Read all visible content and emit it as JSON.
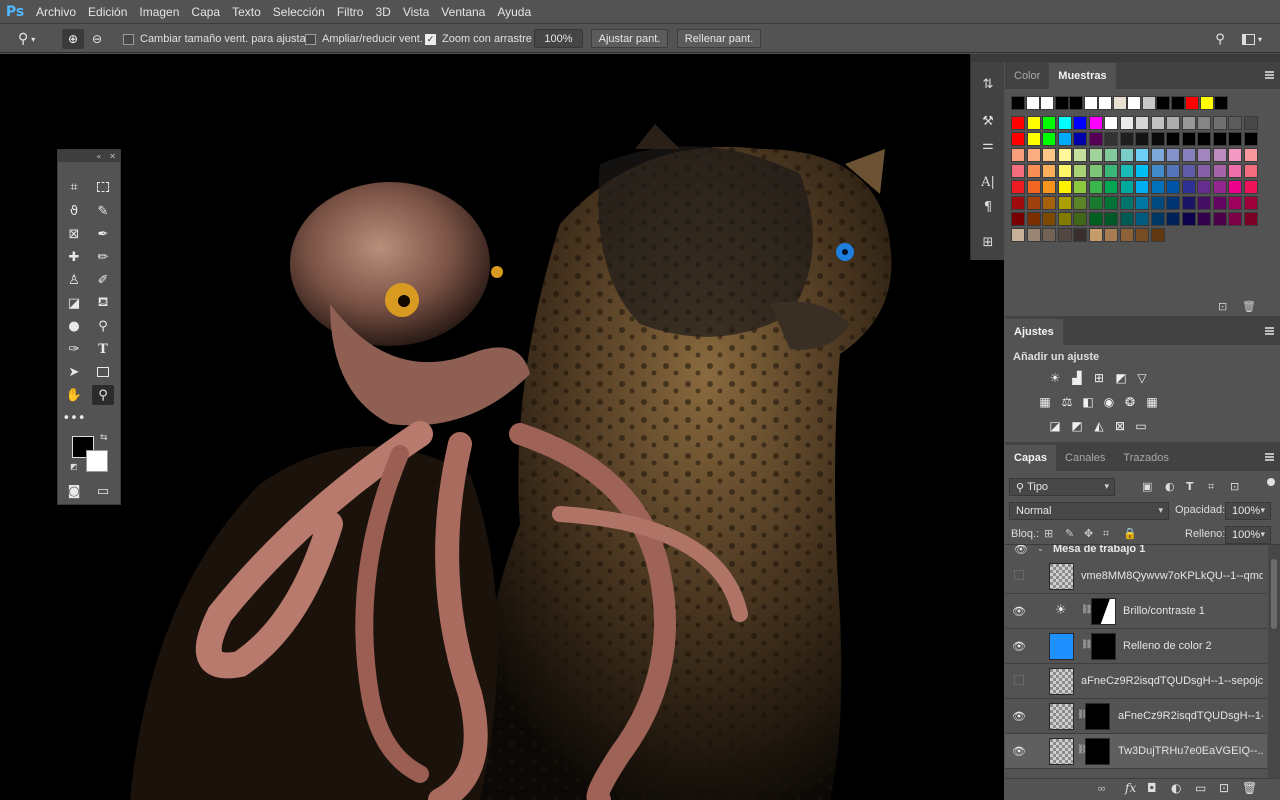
{
  "app": {
    "logo": "Ps"
  },
  "menubar": [
    "Archivo",
    "Edición",
    "Imagen",
    "Capa",
    "Texto",
    "Selección",
    "Filtro",
    "3D",
    "Vista",
    "Ventana",
    "Ayuda"
  ],
  "options": {
    "cb_resize_label": "Cambiar tamaño vent. para ajustar",
    "cb_resize_checked": false,
    "cb_zoom_all_label": "Ampliar/reducir vent.",
    "cb_zoom_all_checked": false,
    "cb_scrubby_label": "Zoom con arrastre",
    "cb_scrubby_checked": true,
    "zoom_value": "100%",
    "fit_label": "Ajustar pant.",
    "fill_label": "Rellenar pant."
  },
  "swatches_panel": {
    "tabs": [
      "Color",
      "Muestras"
    ],
    "active_tab": "Muestras",
    "recent": [
      "#000000",
      "#ffffff",
      "#ffffff",
      "#000000",
      "#000000",
      "#ffffff",
      "#ffffff",
      "#e8e0d0",
      "#ffffff",
      "#c8c8c8",
      "#000000",
      "#000000",
      "#ff0000",
      "#ffff00",
      "#000000"
    ],
    "rows": [
      [
        "#ff0000",
        "#ffff00",
        "#00ff00",
        "#00ffff",
        "#0000ff",
        "#ff00ff",
        "#ffffff",
        "#ebebeb",
        "#d6d6d6",
        "#c2c2c2",
        "#adadad",
        "#999999",
        "#858585",
        "#707070",
        "#5c5c5c",
        "#474747"
      ],
      [
        "#ff0000",
        "#ffff00",
        "#00ff00",
        "#00aaff",
        "#0000aa",
        "#550055",
        "#333333",
        "#1f1f1f",
        "#141414",
        "#0a0a0a",
        "#000000",
        "#000000",
        "#000000",
        "#000000",
        "#000000",
        "#000000"
      ],
      [
        "#f79c7c",
        "#f9ad81",
        "#fdc689",
        "#fff799",
        "#c4df9b",
        "#a3d39c",
        "#82ca9c",
        "#7accc8",
        "#6dcff6",
        "#7da7d9",
        "#8393ca",
        "#8781bd",
        "#a186be",
        "#bd8cbf",
        "#f49ac2",
        "#f6989d"
      ],
      [
        "#f26d7d",
        "#f68e56",
        "#fbaf5d",
        "#fff568",
        "#acd373",
        "#7cc576",
        "#3bb878",
        "#1abbb4",
        "#00bff3",
        "#438ccb",
        "#5574b9",
        "#605ca8",
        "#8560a8",
        "#a763a8",
        "#f06eaa",
        "#f26c7d"
      ],
      [
        "#ed1c24",
        "#f26522",
        "#f7941d",
        "#fff200",
        "#8dc73f",
        "#39b54a",
        "#00a651",
        "#00a99d",
        "#00aeef",
        "#0072bc",
        "#0054a6",
        "#2e3192",
        "#662d91",
        "#92278f",
        "#ec008c",
        "#ed145b"
      ],
      [
        "#9e0b0f",
        "#a0410d",
        "#a36209",
        "#aba000",
        "#598527",
        "#197b30",
        "#007236",
        "#00746b",
        "#0076a3",
        "#004a80",
        "#003471",
        "#1b1464",
        "#440e62",
        "#630460",
        "#9e005d",
        "#9e0039"
      ],
      [
        "#790000",
        "#7b2e00",
        "#7d4900",
        "#827b00",
        "#406618",
        "#005e20",
        "#005826",
        "#005952",
        "#005b7f",
        "#003663",
        "#002157",
        "#0d004c",
        "#32004b",
        "#4b0049",
        "#7b0046",
        "#7a0026"
      ],
      [
        "#c7b299",
        "#998675",
        "#736357",
        "#534741",
        "#37302d",
        "#c69c6d",
        "#a67c52",
        "#8c6239",
        "#754c24",
        "#603913"
      ]
    ]
  },
  "adjustments_panel": {
    "tab": "Ajustes",
    "heading": "Añadir un ajuste"
  },
  "layers_panel": {
    "tabs": [
      "Capas",
      "Canales",
      "Trazados"
    ],
    "active_tab": "Capas",
    "filter_kind": "Tipo",
    "blend_mode": "Normal",
    "opacity_label": "Opacidad:",
    "opacity_value": "100%",
    "lock_label": "Bloq.:",
    "fill_label": "Relleno:",
    "fill_value": "100%",
    "artboard": "Mesa de trabajo 1",
    "layers": [
      {
        "name": "vme8MM8Qywvw7oKPLkQU--1--qmd...",
        "visible": false,
        "thumb": "photo",
        "mask": false,
        "adjust_icon": false
      },
      {
        "name": "Brillo/contraste 1",
        "visible": true,
        "thumb": "sun",
        "mask": true,
        "adjust_icon": true
      },
      {
        "name": "Relleno de color 2",
        "visible": true,
        "thumb": "blue",
        "mask": true,
        "adjust_icon": false
      },
      {
        "name": "aFneCz9R2isqdTQUDsgH--1--sepojc...",
        "visible": false,
        "thumb": "photo",
        "mask": false,
        "adjust_icon": false
      },
      {
        "name": "aFneCz9R2isqdTQUDsgH--1-...",
        "visible": true,
        "thumb": "photo",
        "mask": true,
        "adjust_icon": false
      },
      {
        "name": "Tw3DujTRHu7e0EaVGEIQ--...",
        "visible": true,
        "thumb": "photo",
        "mask": true,
        "adjust_icon": false
      }
    ]
  }
}
